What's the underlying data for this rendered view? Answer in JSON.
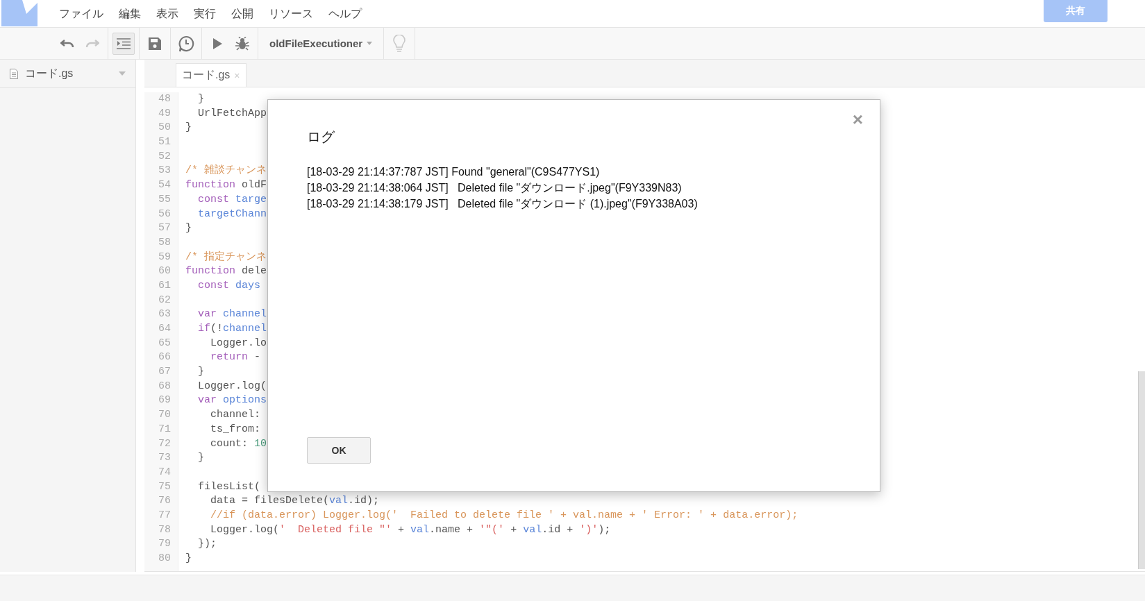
{
  "logo": {
    "kind": "app"
  },
  "menu": [
    "ファイル",
    "編集",
    "表示",
    "実行",
    "公開",
    "リソース",
    "ヘルプ"
  ],
  "share_button": "共有",
  "toolbar": [
    {
      "kind": "undo",
      "disabled": false,
      "on": false
    },
    {
      "kind": "redo",
      "disabled": true,
      "on": false
    },
    {
      "kind": "indent",
      "disabled": false,
      "on": true
    },
    {
      "kind": "save",
      "disabled": false,
      "on": false
    },
    {
      "kind": "triggers",
      "disabled": false,
      "on": false
    },
    {
      "kind": "run",
      "disabled": false,
      "on": false
    },
    {
      "kind": "debug",
      "disabled": false,
      "on": false
    },
    {
      "kind": "function_select",
      "label": "oldFileExecutioner"
    },
    {
      "kind": "bulb",
      "disabled": true,
      "on": false
    }
  ],
  "sidebar": {
    "file": "コード.gs"
  },
  "tab": {
    "label": "コード.gs",
    "close": "×"
  },
  "code_lines": [
    {
      "number": "48",
      "segments": [
        {
          "kind": "plain",
          "text": "  }"
        }
      ]
    },
    {
      "number": "49",
      "segments": [
        {
          "kind": "plain",
          "text": "  UrlFetchApp"
        }
      ]
    },
    {
      "number": "50",
      "segments": [
        {
          "kind": "plain",
          "text": "}"
        }
      ]
    },
    {
      "number": "51"
    },
    {
      "number": "52"
    },
    {
      "number": "53",
      "segments": [
        {
          "kind": "comment",
          "text": "/* 雑談チャンネ"
        }
      ]
    },
    {
      "number": "54",
      "segments": [
        {
          "kind": "keyword",
          "text": "function"
        },
        {
          "kind": "plain",
          "text": " oldF"
        }
      ]
    },
    {
      "number": "55",
      "segments": [
        {
          "kind": "keyword",
          "text": "  const"
        },
        {
          "kind": "variable",
          "text": " targe"
        }
      ]
    },
    {
      "number": "56",
      "segments": [
        {
          "kind": "variable",
          "text": "  targetChann"
        }
      ]
    },
    {
      "number": "57",
      "segments": [
        {
          "kind": "plain",
          "text": "}"
        }
      ]
    },
    {
      "number": "58"
    },
    {
      "number": "59",
      "segments": [
        {
          "kind": "comment",
          "text": "/* 指定チャンネ"
        }
      ]
    },
    {
      "number": "60",
      "segments": [
        {
          "kind": "keyword",
          "text": "function"
        },
        {
          "kind": "plain",
          "text": " dele"
        }
      ]
    },
    {
      "number": "61",
      "segments": [
        {
          "kind": "keyword",
          "text": "  const"
        },
        {
          "kind": "variable",
          "text": " days"
        }
      ]
    },
    {
      "number": "62"
    },
    {
      "number": "63",
      "segments": [
        {
          "kind": "keyword",
          "text": "  var"
        },
        {
          "kind": "variable",
          "text": " channel"
        }
      ]
    },
    {
      "number": "64",
      "segments": [
        {
          "kind": "keyword",
          "text": "  if"
        },
        {
          "kind": "plain",
          "text": "(!"
        },
        {
          "kind": "variable",
          "text": "channel"
        }
      ]
    },
    {
      "number": "65",
      "segments": [
        {
          "kind": "plain",
          "text": "    Logger.lo"
        }
      ]
    },
    {
      "number": "66",
      "segments": [
        {
          "kind": "keyword",
          "text": "    return"
        },
        {
          "kind": "plain",
          "text": " -"
        }
      ]
    },
    {
      "number": "67",
      "segments": [
        {
          "kind": "plain",
          "text": "  }"
        }
      ]
    },
    {
      "number": "68",
      "segments": [
        {
          "kind": "plain",
          "text": "  Logger.log("
        }
      ]
    },
    {
      "number": "69",
      "segments": [
        {
          "kind": "keyword",
          "text": "  var"
        },
        {
          "kind": "variable",
          "text": " options"
        }
      ]
    },
    {
      "number": "70",
      "segments": [
        {
          "kind": "plain",
          "text": "    channel:"
        }
      ]
    },
    {
      "number": "71",
      "segments": [
        {
          "kind": "plain",
          "text": "    ts_from:"
        }
      ]
    },
    {
      "number": "72",
      "segments": [
        {
          "kind": "plain",
          "text": "    count: "
        },
        {
          "kind": "number",
          "text": "10"
        }
      ]
    },
    {
      "number": "73",
      "segments": [
        {
          "kind": "plain",
          "text": "  }"
        }
      ]
    },
    {
      "number": "74"
    },
    {
      "number": "75",
      "segments": [
        {
          "kind": "plain",
          "text": "  filesList("
        }
      ]
    },
    {
      "number": "76",
      "segments": [
        {
          "kind": "plain",
          "text": "    data = filesDelete("
        },
        {
          "kind": "variable",
          "text": "val"
        },
        {
          "kind": "plain",
          "text": ".id);"
        }
      ]
    },
    {
      "number": "77",
      "segments": [
        {
          "kind": "comment",
          "text": "    //if (data.error) Logger.log('  Failed to delete file ' + val.name + ' Error: ' + data.error);"
        }
      ]
    },
    {
      "number": "78",
      "segments": [
        {
          "kind": "plain",
          "text": "    Logger.log("
        },
        {
          "kind": "string",
          "text": "'  Deleted file \"'"
        },
        {
          "kind": "plain",
          "text": " + "
        },
        {
          "kind": "variable",
          "text": "val"
        },
        {
          "kind": "plain",
          "text": ".name + "
        },
        {
          "kind": "string",
          "text": "'\"('"
        },
        {
          "kind": "plain",
          "text": " + "
        },
        {
          "kind": "variable",
          "text": "val"
        },
        {
          "kind": "plain",
          "text": ".id + "
        },
        {
          "kind": "string",
          "text": "')'"
        },
        {
          "kind": "plain",
          "text": ");"
        }
      ]
    },
    {
      "number": "79",
      "segments": [
        {
          "kind": "plain",
          "text": "  });"
        }
      ]
    },
    {
      "number": "80",
      "segments": [
        {
          "kind": "plain",
          "text": "}"
        }
      ]
    }
  ],
  "dialog": {
    "title": "ログ",
    "close": "×",
    "log_lines": [
      "[18-03-29 21:14:37:787 JST] Found \"general\"(C9S477YS1)",
      "[18-03-29 21:14:38:064 JST]   Deleted file \"ダウンロード.jpeg\"(F9Y339N83)",
      "[18-03-29 21:14:38:179 JST]   Deleted file \"ダウンロード (1).jpeg\"(F9Y338A03)"
    ],
    "ok_button": "OK"
  }
}
